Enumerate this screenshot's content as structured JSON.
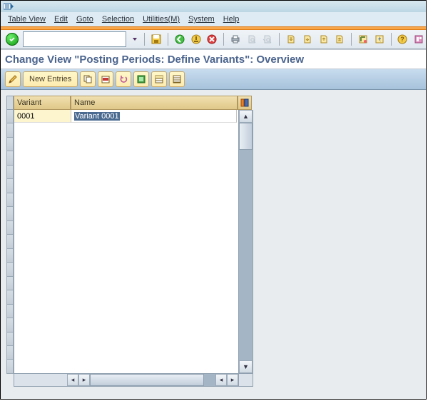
{
  "menu": {
    "table_view": "Table View",
    "edit": "Edit",
    "goto": "Goto",
    "selection": "Selection",
    "utilities": "Utilities(M)",
    "system": "System",
    "help": "Help"
  },
  "screen": {
    "title": "Change View \"Posting Periods: Define Variants\": Overview"
  },
  "apptoolbar": {
    "new_entries": "New Entries"
  },
  "table": {
    "columns": {
      "variant": "Variant",
      "name": "Name"
    },
    "rows": [
      {
        "variant": "0001",
        "name": "Variant 0001"
      }
    ]
  }
}
